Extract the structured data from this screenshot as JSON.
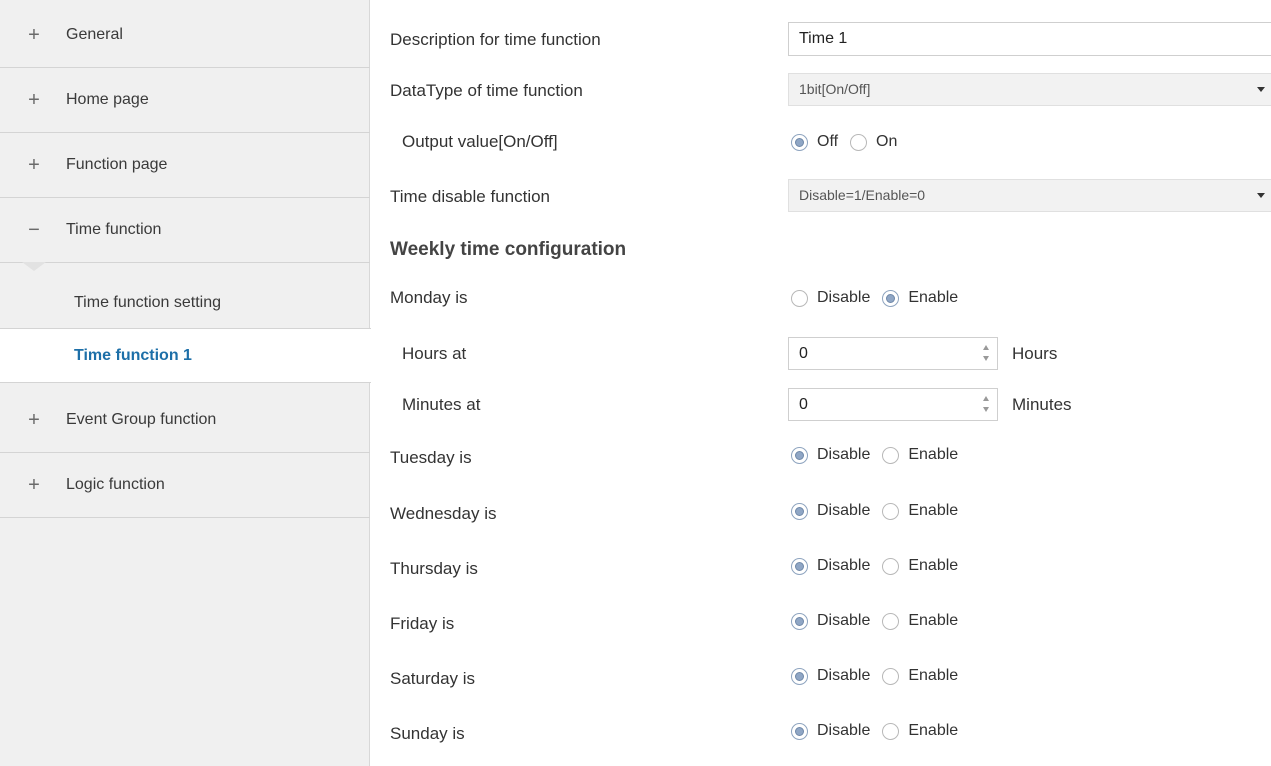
{
  "sidebar": {
    "items": [
      {
        "sign": "+",
        "label": "General"
      },
      {
        "sign": "+",
        "label": "Home page"
      },
      {
        "sign": "+",
        "label": "Function page"
      },
      {
        "sign": "−",
        "label": "Time function"
      },
      {
        "sign": "+",
        "label": "Event Group function"
      },
      {
        "sign": "+",
        "label": "Logic function"
      }
    ],
    "sub_items": [
      {
        "label": "Time function setting"
      },
      {
        "label": "Time function 1"
      }
    ]
  },
  "main": {
    "description": {
      "label": "Description for time function",
      "value": "Time 1"
    },
    "datatype": {
      "label": "DataType of time function",
      "value": "1bit[On/Off]"
    },
    "output": {
      "label": "Output value[On/Off]",
      "options": [
        "Off",
        "On"
      ],
      "selected": "Off"
    },
    "disable": {
      "label": "Time disable function",
      "value": "Disable=1/Enable=0"
    },
    "weekly_heading": "Weekly time configuration",
    "days": [
      {
        "label": "Monday is",
        "selected": "Enable"
      },
      {
        "label": "Tuesday is",
        "selected": "Disable"
      },
      {
        "label": "Wednesday is",
        "selected": "Disable"
      },
      {
        "label": "Thursday is",
        "selected": "Disable"
      },
      {
        "label": "Friday is",
        "selected": "Disable"
      },
      {
        "label": "Saturday is",
        "selected": "Disable"
      },
      {
        "label": "Sunday is",
        "selected": "Disable"
      }
    ],
    "day_options": [
      "Disable",
      "Enable"
    ],
    "hours": {
      "label": "Hours at",
      "value": "0",
      "unit": "Hours"
    },
    "minutes": {
      "label": "Minutes at",
      "value": "0",
      "unit": "Minutes"
    }
  },
  "colors": {
    "accent": "#1d6fa8",
    "sidebar_bg": "#f0f0f0",
    "radio_fill": "#8fa6c5"
  },
  "icons": {
    "expand": "plus-icon",
    "collapse": "minus-icon",
    "dropdown": "caret-down-icon",
    "spinner": "spinner-arrows-icon"
  }
}
